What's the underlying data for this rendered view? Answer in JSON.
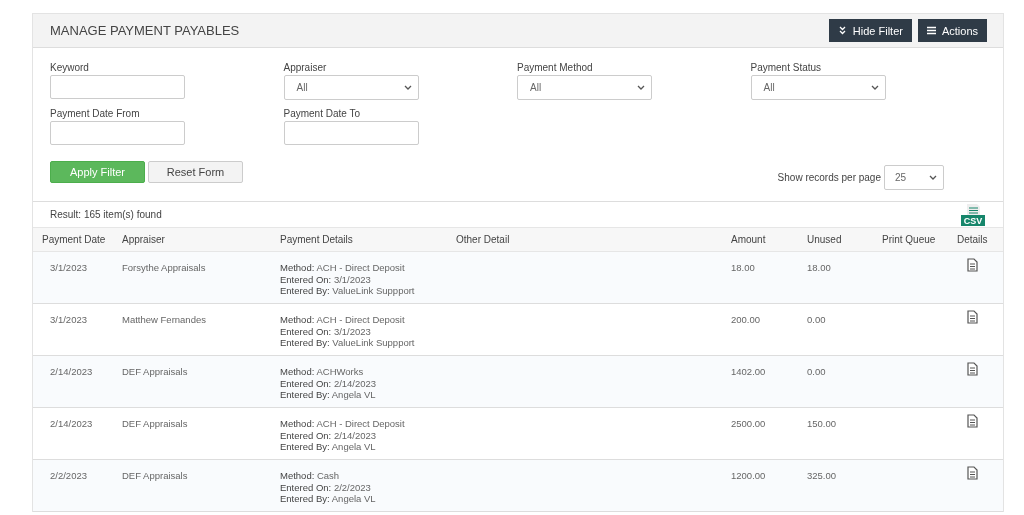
{
  "title": "MANAGE PAYMENT PAYABLES",
  "header_buttons": [
    {
      "label": "Hide Filter",
      "kind": "collapse"
    },
    {
      "label": "Actions",
      "kind": "menu"
    }
  ],
  "filters": [
    {
      "label": "Keyword",
      "kind": "text"
    },
    {
      "label": "Appraiser",
      "kind": "select",
      "value": "All"
    },
    {
      "label": "Payment Method",
      "kind": "select",
      "value": "All"
    },
    {
      "label": "Payment Status",
      "kind": "select",
      "value": "All"
    },
    {
      "label": "Payment Date From",
      "kind": "text"
    },
    {
      "label": "Payment Date To",
      "kind": "text"
    }
  ],
  "apply_button": "Apply Filter",
  "reset_button": "Reset Form",
  "per_page": {
    "label": "Show records per page",
    "value": "25"
  },
  "result": "Result: 165 item(s) found",
  "export_icon_label": "CSV",
  "columns": [
    "Payment Date",
    "Appraiser",
    "Payment Details",
    "Other Detail",
    "Amount",
    "Unused",
    "Print Queue",
    "Details"
  ],
  "rows": [
    {
      "date": "3/1/2023",
      "appraiser": "Forsythe Appraisals",
      "details": [
        {
          "label": "Method:",
          "value": "ACH - Direct Deposit"
        },
        {
          "label": "Entered On:",
          "value": "3/1/2023"
        },
        {
          "label": "Entered By:",
          "value": "ValueLink Suppport"
        }
      ],
      "amount": "18.00",
      "unused": "18.00"
    },
    {
      "date": "3/1/2023",
      "appraiser": "Matthew Fernandes",
      "details": [
        {
          "label": "Method:",
          "value": "ACH - Direct Deposit"
        },
        {
          "label": "Entered On:",
          "value": "3/1/2023"
        },
        {
          "label": "Entered By:",
          "value": "ValueLink Suppport"
        }
      ],
      "amount": "200.00",
      "unused": "0.00"
    },
    {
      "date": "2/14/2023",
      "appraiser": "DEF Appraisals",
      "details": [
        {
          "label": "Method:",
          "value": "ACHWorks"
        },
        {
          "label": "Entered On:",
          "value": "2/14/2023"
        },
        {
          "label": "Entered By:",
          "value": "Angela VL"
        }
      ],
      "amount": "1402.00",
      "unused": "0.00"
    },
    {
      "date": "2/14/2023",
      "appraiser": "DEF Appraisals",
      "details": [
        {
          "label": "Method:",
          "value": "ACH - Direct Deposit"
        },
        {
          "label": "Entered On:",
          "value": "2/14/2023"
        },
        {
          "label": "Entered By:",
          "value": "Angela VL"
        }
      ],
      "amount": "2500.00",
      "unused": "150.00"
    },
    {
      "date": "2/2/2023",
      "appraiser": "DEF Appraisals",
      "details": [
        {
          "label": "Method:",
          "value": "Cash"
        },
        {
          "label": "Entered On:",
          "value": "2/2/2023"
        },
        {
          "label": "Entered By:",
          "value": "Angela VL"
        }
      ],
      "amount": "1200.00",
      "unused": "325.00"
    }
  ]
}
